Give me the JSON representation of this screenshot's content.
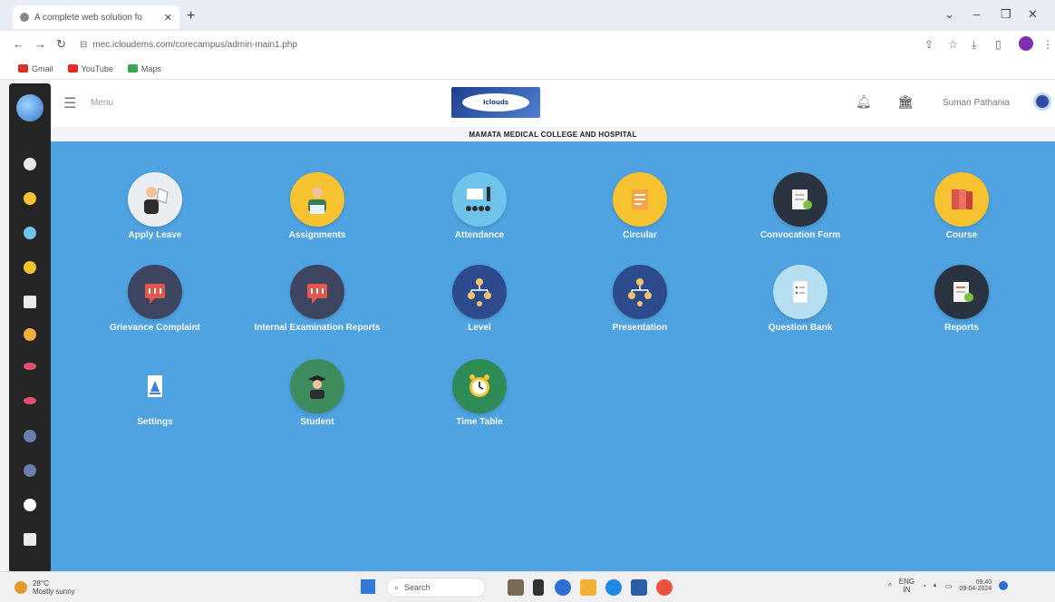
{
  "browser": {
    "tab_title": "A complete web solution fo",
    "url": "mec.icloudems.com/corecampus/admin-main1.php",
    "bookmarks": [
      {
        "label": "Gmail",
        "color": "#d93025"
      },
      {
        "label": "YouTube",
        "color": "#e52d27"
      },
      {
        "label": "Maps",
        "color": "#34a853"
      }
    ]
  },
  "header": {
    "menu_label": "Menu",
    "brand": "Iclouds",
    "user_name": "Suman Pathania"
  },
  "banner": "MAMATA MEDICAL COLLEGE AND HOSPITAL",
  "tiles": [
    {
      "label": "Apply Leave",
      "icon": "apply-leave-icon",
      "bg": "#eaeef3"
    },
    {
      "label": "Assignments",
      "icon": "assignments-icon",
      "bg": "#f6c230"
    },
    {
      "label": "Attendance",
      "icon": "attendance-icon",
      "bg": "#6fc4eb"
    },
    {
      "label": "Circular",
      "icon": "circular-icon",
      "bg": "#f6c230"
    },
    {
      "label": "Convocation Form",
      "icon": "convocation-form-icon",
      "bg": "#2c3340"
    },
    {
      "label": "Course",
      "icon": "course-icon",
      "bg": "#f6c230"
    },
    {
      "label": "Grievance Complaint",
      "icon": "grievance-complaint-icon",
      "bg": "#3d4560"
    },
    {
      "label": "Internal Examination Reports",
      "icon": "internal-examination-reports-icon",
      "bg": "#3d4560"
    },
    {
      "label": "Level",
      "icon": "level-icon",
      "bg": "#2d4b8c"
    },
    {
      "label": "Presentation",
      "icon": "presentation-icon",
      "bg": "#2d4b8c"
    },
    {
      "label": "Question Bank",
      "icon": "question-bank-icon",
      "bg": "#b6e0f2"
    },
    {
      "label": "Reports",
      "icon": "reports-icon",
      "bg": "#2c3340"
    },
    {
      "label": "Settings",
      "icon": "settings-icon",
      "bg": "#4fa3e1"
    },
    {
      "label": "Student",
      "icon": "student-icon",
      "bg": "#3e8c5e"
    },
    {
      "label": "Time Table",
      "icon": "time-table-icon",
      "bg": "#2e8b55"
    }
  ],
  "taskbar": {
    "weather_temp": "28°C",
    "weather_desc": "Mostly sunny",
    "search_label": "Search",
    "lang": "ENG",
    "lang_region": "IN",
    "time": "09:40",
    "date": "09-04-2024"
  }
}
